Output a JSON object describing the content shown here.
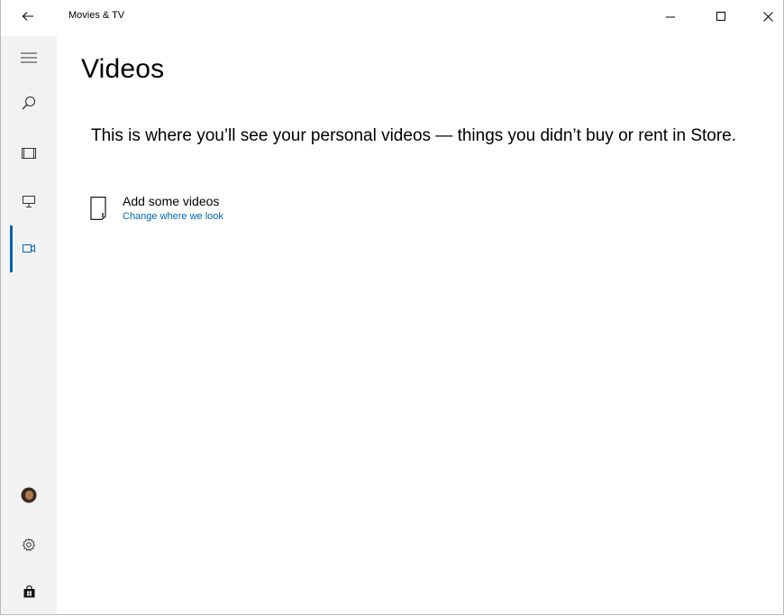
{
  "window": {
    "app_title": "Movies & TV"
  },
  "icons": {
    "back": "back-arrow-icon",
    "minimize": "minimize-icon",
    "maximize": "maximize-icon",
    "close": "close-icon",
    "hamburger": "hamburger-menu-icon",
    "search": "search-icon",
    "movies": "movies-icon",
    "tv": "tv-icon",
    "videos": "video-camera-icon",
    "account": "account-avatar",
    "settings": "gear-icon",
    "store": "store-bag-icon",
    "folder": "folder-icon"
  },
  "colors": {
    "accent": "#0063b1",
    "sidebar_bg": "#f2f2f2"
  },
  "main": {
    "title": "Videos",
    "description": "This is where you’ll see your personal videos — things you didn’t buy or rent in Store.",
    "add_videos_label": "Add some videos",
    "change_location_link": "Change where we look"
  }
}
